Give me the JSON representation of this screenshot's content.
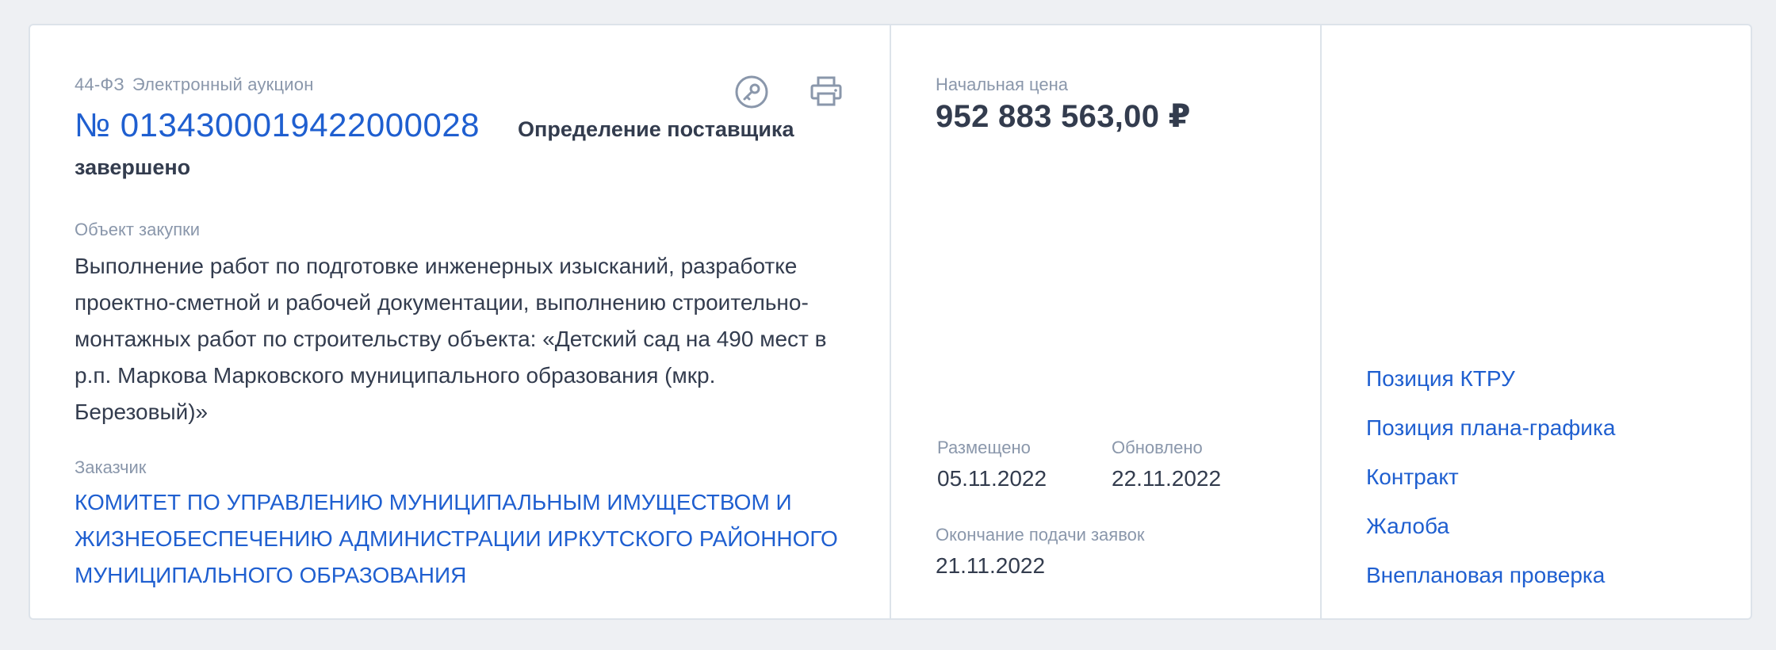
{
  "purchase": {
    "law": "44-ФЗ",
    "method": "Электронный аукцион",
    "number": "№ 0134300019422000028",
    "status_part1": "Определение поставщика",
    "status_part2": "завершено",
    "object_label": "Объект закупки",
    "object_text": "Выполнение работ по подготовке инженерных изысканий, разработке проектно-сметной и рабочей документации, выполнению строительно-монтажных работ по строительству объекта: «Детский сад на 490 мест в р.п. Маркова Марковского муниципального образования (мкр. Березовый)»",
    "customer_label": "Заказчик",
    "customer_name": "КОМИТЕТ ПО УПРАВЛЕНИЮ МУНИЦИПАЛЬНЫМ ИМУЩЕСТВОМ И ЖИЗНЕОБЕСПЕЧЕНИЮ АДМИНИСТРАЦИИ ИРКУТСКОГО РАЙОННОГО МУНИЦИПАЛЬНОГО ОБРАЗОВАНИЯ"
  },
  "icons": {
    "key": "key-icon",
    "print": "printer-icon",
    "color": "#8a97ab"
  },
  "price": {
    "label": "Начальная цена",
    "value": "952 883 563,00 ₽"
  },
  "dates": {
    "posted_label": "Размещено",
    "posted_value": "05.11.2022",
    "updated_label": "Обновлено",
    "updated_value": "22.11.2022",
    "deadline_label": "Окончание подачи заявок",
    "deadline_value": "21.11.2022"
  },
  "links": [
    "Позиция КТРУ",
    "Позиция плана-графика",
    "Контракт",
    "Жалоба",
    "Внеплановая проверка"
  ],
  "colors": {
    "link": "#1f5fd0",
    "text": "#333c4e",
    "muted": "#8a97ab",
    "border": "#dde3ea",
    "background": "#eef0f3"
  }
}
